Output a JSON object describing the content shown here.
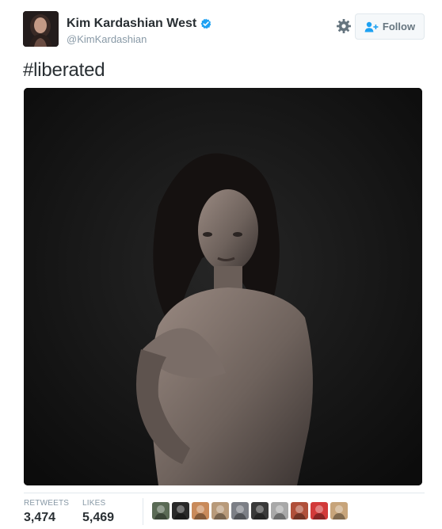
{
  "tweet": {
    "author": {
      "full_name": "Kim Kardashian West",
      "username": "@KimKardashian",
      "verified": true,
      "avatar_icon": "profile-avatar"
    },
    "header": {
      "settings_icon": "gear-icon",
      "follow_label": "Follow",
      "follow_icon": "add-user-icon"
    },
    "text": "#liberated",
    "media": {
      "kind": "black-and-white portrait photo"
    },
    "stats": {
      "retweets_label": "RETWEETS",
      "retweets_value": "3,474",
      "likes_label": "LIKES",
      "likes_value": "5,469"
    },
    "likers": [
      {
        "name": "liker-avatar-1",
        "color": "#5a6a55"
      },
      {
        "name": "liker-avatar-2",
        "color": "#2a2a2a"
      },
      {
        "name": "liker-avatar-3",
        "color": "#c98a5a"
      },
      {
        "name": "liker-avatar-4",
        "color": "#b89a7a"
      },
      {
        "name": "liker-avatar-5",
        "color": "#7c7f86"
      },
      {
        "name": "liker-avatar-6",
        "color": "#3a3a3a"
      },
      {
        "name": "liker-avatar-7",
        "color": "#a8a8a8"
      },
      {
        "name": "liker-avatar-8",
        "color": "#b0503a"
      },
      {
        "name": "liker-avatar-9",
        "color": "#d23a3a"
      },
      {
        "name": "liker-avatar-10",
        "color": "#c7a47a"
      }
    ]
  },
  "colors": {
    "verified_blue": "#1da1f2",
    "secondary_text": "#8899a6",
    "primary_text": "#292f33",
    "border": "#e1e8ed",
    "button_bg": "#f5f8fa"
  }
}
